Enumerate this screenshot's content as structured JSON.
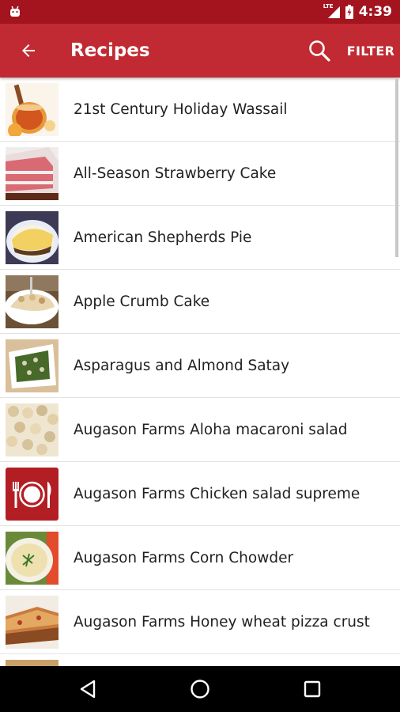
{
  "status_bar": {
    "network": "LTE",
    "time": "4:39"
  },
  "app_bar": {
    "title": "Recipes",
    "filter_label": "FILTER"
  },
  "recipes": [
    {
      "name": "21st Century Holiday Wassail"
    },
    {
      "name": "All-Season Strawberry Cake"
    },
    {
      "name": "American Shepherds Pie"
    },
    {
      "name": "Apple Crumb Cake"
    },
    {
      "name": "Asparagus and Almond Satay"
    },
    {
      "name": "Augason Farms Aloha macaroni salad"
    },
    {
      "name": "Augason Farms Chicken salad supreme"
    },
    {
      "name": "Augason Farms Corn Chowder"
    },
    {
      "name": "Augason Farms Honey wheat pizza crust"
    }
  ],
  "colors": {
    "status_bar": "#a3141f",
    "app_bar": "#c12a32",
    "placeholder_tile": "#b31e25"
  }
}
